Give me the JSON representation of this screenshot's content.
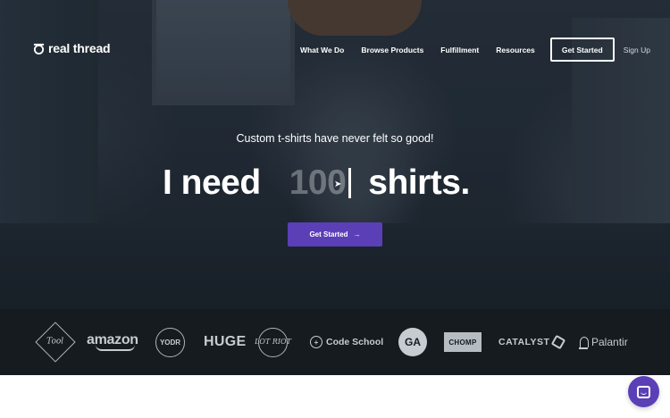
{
  "colors": {
    "accent": "#5a3fb7",
    "hero_overlay": "#1b242d",
    "logo_bar_bg": "#151b1f",
    "text_light": "#ffffff"
  },
  "nav": {
    "logo_text": "real thread",
    "logo_icon": "thread-spool-icon",
    "links": [
      "What We Do",
      "Browse Products",
      "Fulfillment",
      "Resources"
    ],
    "cta_label": "Get Started",
    "signup_label": "Sign Up"
  },
  "hero": {
    "tagline": "Custom t-shirts have never felt so good!",
    "headline_prefix": "I need",
    "headline_number": "100",
    "headline_suffix": "shirts.",
    "cta_label": "Get Started",
    "cta_icon": "arrow-right-icon"
  },
  "client_logos": {
    "tool": "Tool",
    "amazon": "amazon",
    "yodr": "YODR",
    "huge": "HUGE",
    "lot_riot": "LOT RIOT",
    "code_school": "Code School",
    "ga": "GA",
    "chomp": "CHOMP",
    "catalyst": "CATALYST",
    "palantir": "Palantir"
  },
  "chat": {
    "icon": "chat-bubble-icon"
  }
}
